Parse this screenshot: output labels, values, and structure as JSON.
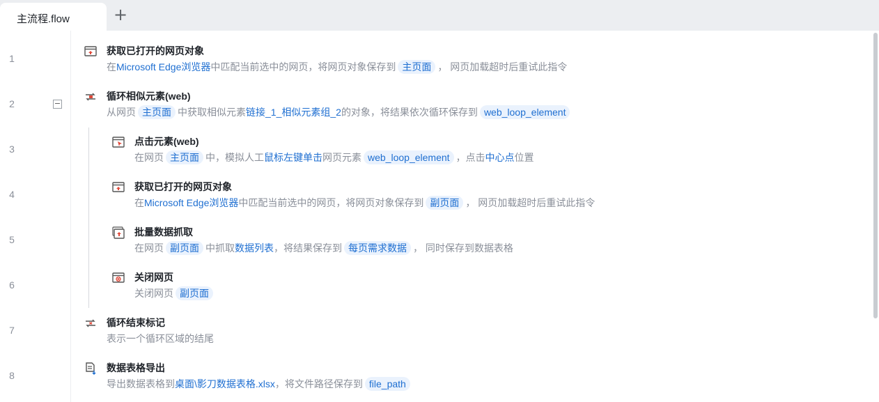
{
  "tab": {
    "title": "主流程.flow",
    "add_label": "+"
  },
  "fold": {
    "collapse_symbol": "−"
  },
  "steps": [
    {
      "line": "1",
      "title": "获取已打开的网页对象",
      "icon": "browser-open-icon",
      "desc": [
        {
          "t": "text",
          "v": "在"
        },
        {
          "t": "kw",
          "v": "Microsoft Edge浏览器"
        },
        {
          "t": "text",
          "v": "中匹配当前选中的网页，将网页对象保存到"
        },
        {
          "t": "chip",
          "v": "主页面"
        },
        {
          "t": "text",
          "v": "， 网页加载超时后重试此指令"
        }
      ]
    },
    {
      "line": "2",
      "title": "循环相似元素(web)",
      "icon": "loop-element-icon",
      "desc": [
        {
          "t": "text",
          "v": "从网页"
        },
        {
          "t": "chip",
          "v": "主页面"
        },
        {
          "t": "text",
          "v": "中获取相似元素"
        },
        {
          "t": "kw",
          "v": "链接_1_相似元素组_2"
        },
        {
          "t": "text",
          "v": "的对象，将结果依次循环保存到"
        },
        {
          "t": "chip",
          "v": "web_loop_element"
        }
      ]
    },
    {
      "line": "3",
      "title": "点击元素(web)",
      "icon": "click-element-icon",
      "desc": [
        {
          "t": "text",
          "v": "在网页"
        },
        {
          "t": "chip",
          "v": "主页面"
        },
        {
          "t": "text",
          "v": "中，模拟人工"
        },
        {
          "t": "kw",
          "v": "鼠标左键单击"
        },
        {
          "t": "text",
          "v": "网页元素"
        },
        {
          "t": "chip",
          "v": "web_loop_element"
        },
        {
          "t": "text",
          "v": "，点击"
        },
        {
          "t": "kw",
          "v": "中心点"
        },
        {
          "t": "text",
          "v": "位置"
        }
      ]
    },
    {
      "line": "4",
      "title": "获取已打开的网页对象",
      "icon": "browser-open-icon",
      "desc": [
        {
          "t": "text",
          "v": "在"
        },
        {
          "t": "kw",
          "v": "Microsoft Edge浏览器"
        },
        {
          "t": "text",
          "v": "中匹配当前选中的网页，将网页对象保存到"
        },
        {
          "t": "chip",
          "v": "副页面"
        },
        {
          "t": "text",
          "v": "， 网页加载超时后重试此指令"
        }
      ]
    },
    {
      "line": "5",
      "title": "批量数据抓取",
      "icon": "batch-scrape-icon",
      "desc": [
        {
          "t": "text",
          "v": "在网页"
        },
        {
          "t": "chip",
          "v": "副页面"
        },
        {
          "t": "text",
          "v": "中抓取"
        },
        {
          "t": "kw",
          "v": "数据列表"
        },
        {
          "t": "text",
          "v": "，将结果保存到"
        },
        {
          "t": "chip",
          "v": "每页需求数据"
        },
        {
          "t": "text",
          "v": "， 同时保存到数据表格"
        }
      ]
    },
    {
      "line": "6",
      "title": "关闭网页",
      "icon": "close-page-icon",
      "desc": [
        {
          "t": "text",
          "v": "关闭网页"
        },
        {
          "t": "chip",
          "v": "副页面"
        }
      ]
    },
    {
      "line": "7",
      "title": "循环结束标记",
      "icon": "loop-end-icon",
      "desc": [
        {
          "t": "text",
          "v": "表示一个循环区域的结尾"
        }
      ]
    },
    {
      "line": "8",
      "title": "数据表格导出",
      "icon": "table-export-icon",
      "desc": [
        {
          "t": "text",
          "v": "导出数据表格到"
        },
        {
          "t": "kw",
          "v": "桌面\\影刀数据表格.xlsx"
        },
        {
          "t": "text",
          "v": "，将文件路径保存到"
        },
        {
          "t": "chip",
          "v": "file_path"
        }
      ]
    }
  ],
  "colors": {
    "accent": "#1f6fd1",
    "chip_bg": "#eaf2fd",
    "muted_text": "#8a8f99",
    "icon_red": "#e0493a"
  }
}
